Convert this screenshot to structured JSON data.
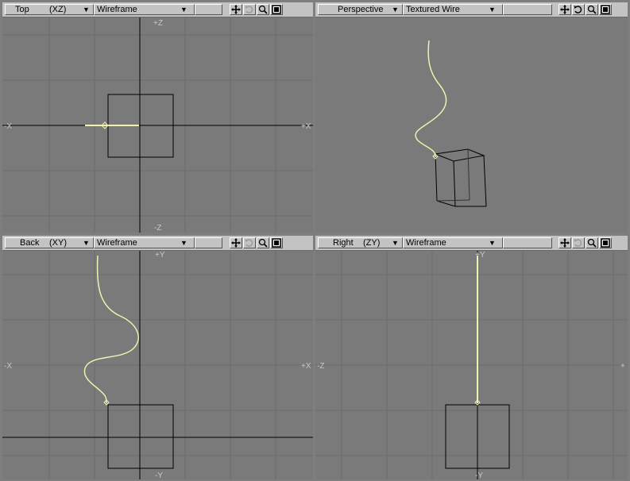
{
  "viewports": {
    "top_left": {
      "view": "Top",
      "axes": "(XZ)",
      "mode": "Wireframe",
      "axis_labels": {
        "top": "+Z",
        "bottom": "-Z",
        "left": "-X",
        "right": "+X"
      }
    },
    "top_right": {
      "view": "Perspective",
      "axes": "",
      "mode": "Textured Wire"
    },
    "bottom_left": {
      "view": "Back",
      "axes": "(XY)",
      "mode": "Wireframe",
      "axis_labels": {
        "top": "+Y",
        "bottom": "-Y",
        "left": "-X",
        "right": "+X"
      }
    },
    "bottom_right": {
      "view": "Right",
      "axes": "(ZY)",
      "mode": "Wireframe",
      "axis_labels": {
        "top": "+Y",
        "bottom": "-Y",
        "left": "-Z",
        "right": "+"
      }
    }
  },
  "toolbar_buttons": [
    "move-icon",
    "rotate-icon",
    "zoom-icon",
    "maximize-icon"
  ],
  "colors": {
    "viewport_bg": "#7a7a7a",
    "toolbar_bg": "#c3c3c3",
    "grid": "#6c6c6c",
    "axis": "#000000",
    "wire": "#000000",
    "curve": "#f0f0b0"
  }
}
